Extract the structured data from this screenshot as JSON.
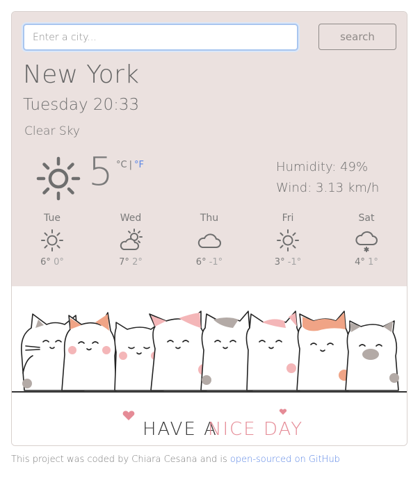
{
  "search": {
    "placeholder": "Enter a city...",
    "button_label": "search"
  },
  "current": {
    "city": "New York",
    "datetime": "Tuesday 20:33",
    "description": "Clear Sky",
    "icon": "sun-icon",
    "temperature": "5",
    "unit_celsius": "°C",
    "unit_separator": "|",
    "unit_fahrenheit": "°F",
    "humidity": "Humidity: 49%",
    "wind": "Wind: 3.13 km/h"
  },
  "forecast": [
    {
      "day": "Tue",
      "icon": "sun-icon",
      "high": "6°",
      "low": "0°"
    },
    {
      "day": "Wed",
      "icon": "partly-cloudy-icon",
      "high": "7°",
      "low": "2°"
    },
    {
      "day": "Thu",
      "icon": "cloud-icon",
      "high": "6°",
      "low": "-1°"
    },
    {
      "day": "Fri",
      "icon": "sun-icon",
      "high": "3°",
      "low": "-1°"
    },
    {
      "day": "Sat",
      "icon": "snow-icon",
      "high": "4°",
      "low": "1°"
    }
  ],
  "banner": {
    "text_part1": "HAVE A",
    "text_part2": "NICE DAY"
  },
  "footer": {
    "text": "This project was coded by Chiara Cesana and is",
    "link_text": "open-sourced on GitHub"
  },
  "colors": {
    "panel_background": "#ebe1df",
    "accent_blue": "#5b86e5",
    "nice_day_pink": "#e58b96",
    "cat_patch_orange": "#f0a486",
    "cat_patch_pink": "#f4b6b8",
    "cat_patch_grey": "#b3aaa6"
  }
}
